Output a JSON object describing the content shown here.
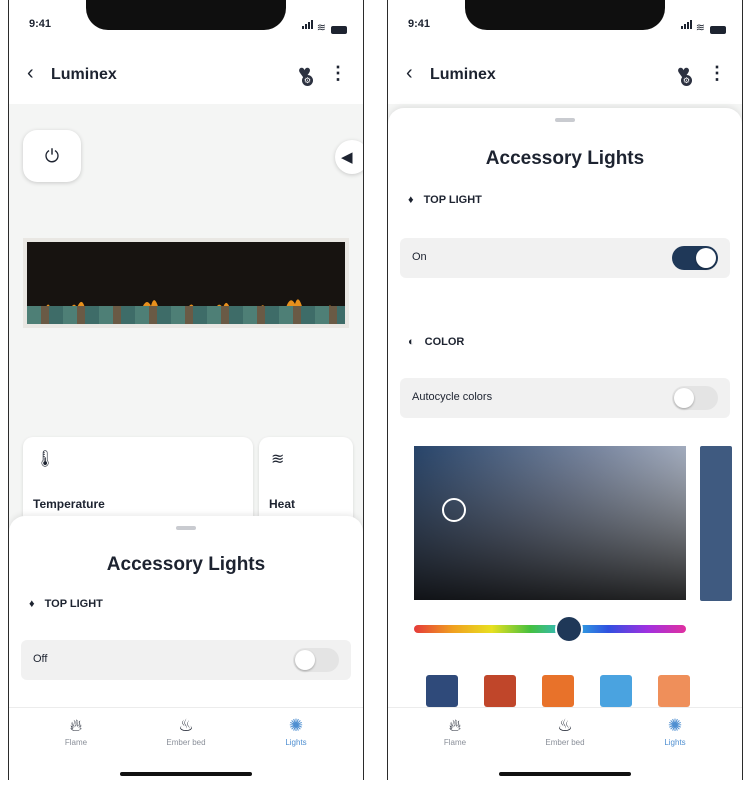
{
  "status": {
    "time": "9:41"
  },
  "header": {
    "title": "Luminex"
  },
  "icons": {
    "back": "chevron-left-icon",
    "favorite": "heart-settings-icon",
    "more": "kebab-icon"
  },
  "screen1": {
    "cards": [
      {
        "label": "Temperature",
        "icon": "thermometer-icon"
      },
      {
        "label": "Heat",
        "icon": "heat-waves-icon"
      }
    ],
    "sheet": {
      "title": "Accessory Lights",
      "section": "TOP LIGHT",
      "row_label": "Off",
      "toggle_state": "off"
    }
  },
  "screen2": {
    "sheet": {
      "title": "Accessory Lights",
      "top_light": {
        "section": "TOP LIGHT",
        "row_label": "On",
        "toggle_state": "on"
      },
      "color": {
        "section": "COLOR",
        "row_label": "Autocycle colors",
        "toggle_state": "off"
      },
      "preview_color": "#3f5a80",
      "hue_value": 0.57,
      "swatches": [
        "#2f4a7a",
        "#c0462a",
        "#e8722a",
        "#4aa3e0",
        "#ef8f5a"
      ]
    }
  },
  "tabs": [
    {
      "label": "Flame",
      "icon": "flame-icon",
      "active": false
    },
    {
      "label": "Ember bed",
      "icon": "ember-bed-icon",
      "active": false
    },
    {
      "label": "Lights",
      "icon": "light-icon",
      "active": true
    }
  ],
  "colors": {
    "accent": "#1f3858",
    "tab_active": "#4f8fd1"
  }
}
